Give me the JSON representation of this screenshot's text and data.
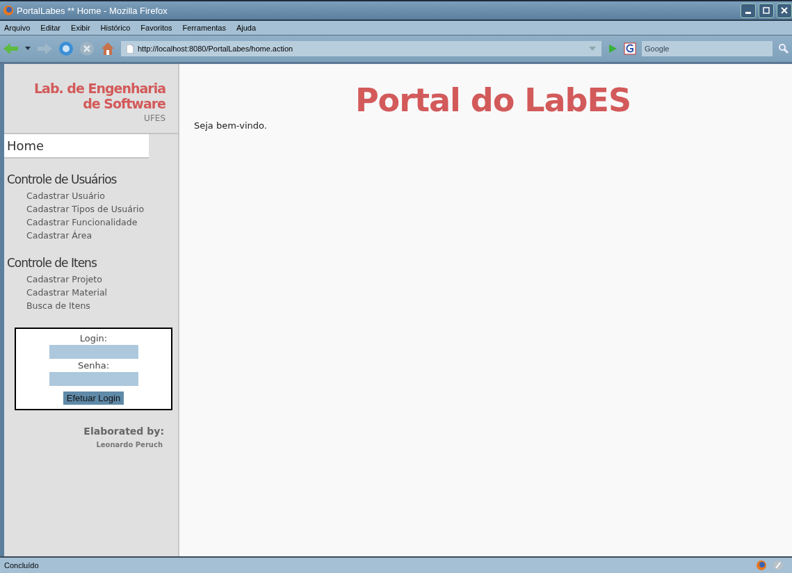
{
  "window": {
    "title": "PortalLabes ** Home - Mozilla Firefox"
  },
  "menu": [
    "Arquivo",
    "Editar",
    "Exibir",
    "Histórico",
    "Favoritos",
    "Ferramentas",
    "Ajuda"
  ],
  "address_bar": {
    "value": "http://localhost:8080/PortalLabes/home.action"
  },
  "search": {
    "placeholder": "Google"
  },
  "sidebar": {
    "logo_line_1": "Lab. de Engenharia",
    "logo_line_2": "de Software",
    "logo_sub": "UFES",
    "home": {
      "label": "Home",
      "selected": true
    },
    "sections": [
      {
        "title": "Controle de Usuários",
        "items": [
          "Cadastrar Usuário",
          "Cadastrar Tipos de Usuário",
          "Cadastrar Funcionalidade",
          "Cadastrar Área"
        ]
      },
      {
        "title": "Controle de Itens",
        "items": [
          "Cadastrar Projeto",
          "Cadastrar Material",
          "Busca de Itens"
        ]
      }
    ],
    "login": {
      "login_label": "Login:",
      "password_label": "Senha:",
      "button": "Efetuar Login"
    },
    "credits_title": "Elaborated by:",
    "credits_name": "Leonardo Peruch"
  },
  "main": {
    "heading": "Portal do LabES",
    "welcome": "Seja bem-vindo."
  },
  "status_bar": {
    "text": "Concluído"
  }
}
